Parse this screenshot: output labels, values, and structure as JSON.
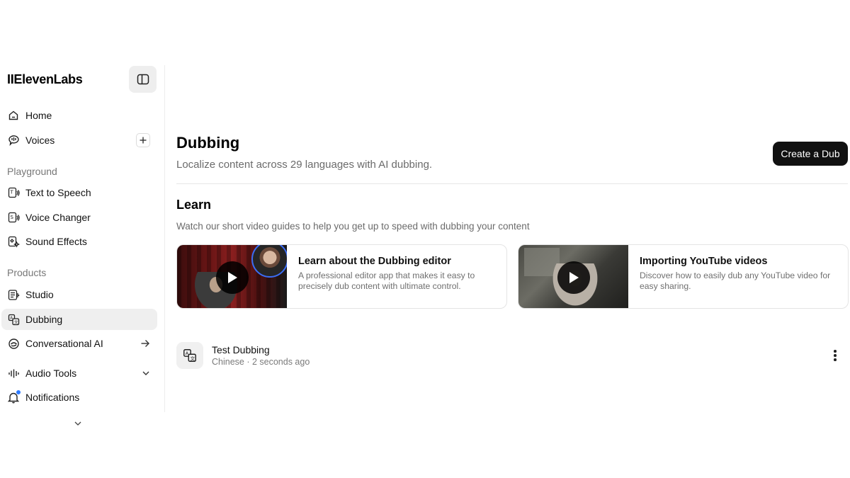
{
  "brand": {
    "logo_text": "IIElevenLabs"
  },
  "sidebar": {
    "collapse_icon": "panel-toggle-icon",
    "items_top": [
      {
        "label": "Home",
        "icon": "home-icon"
      },
      {
        "label": "Voices",
        "icon": "voices-icon"
      }
    ],
    "playground_label": "Playground",
    "playground_items": [
      {
        "label": "Text to Speech",
        "icon": "text-to-speech-icon"
      },
      {
        "label": "Voice Changer",
        "icon": "voice-changer-icon"
      },
      {
        "label": "Sound Effects",
        "icon": "sound-effects-icon"
      }
    ],
    "products_label": "Products",
    "products_items": [
      {
        "label": "Studio",
        "icon": "studio-icon"
      },
      {
        "label": "Dubbing",
        "icon": "dubbing-icon",
        "active": true
      },
      {
        "label": "Conversational AI",
        "icon": "conversational-ai-icon"
      },
      {
        "label": "Audio Tools",
        "icon": "audio-tools-icon"
      },
      {
        "label": "Notifications",
        "icon": "bell-icon"
      }
    ]
  },
  "header": {
    "title": "Dubbing",
    "subtitle": "Localize content across 29 languages with AI dubbing.",
    "create_button": "Create a Dub"
  },
  "learn": {
    "title": "Learn",
    "subtitle": "Watch our short video guides to help you get up to speed with dubbing your content",
    "cards": [
      {
        "title": "Learn about the Dubbing editor",
        "description": "A professional editor app that makes it easy to precisely dub content with ultimate control."
      },
      {
        "title": "Importing YouTube videos",
        "description": "Discover how to easily dub any YouTube video for easy sharing."
      }
    ]
  },
  "dubs": [
    {
      "name": "Test Dubbing",
      "meta": "Chinese · 2 seconds ago"
    }
  ],
  "colors": {
    "accent": "#111111",
    "active_nav": "#efefef",
    "notification_dot": "#2f7bff"
  }
}
